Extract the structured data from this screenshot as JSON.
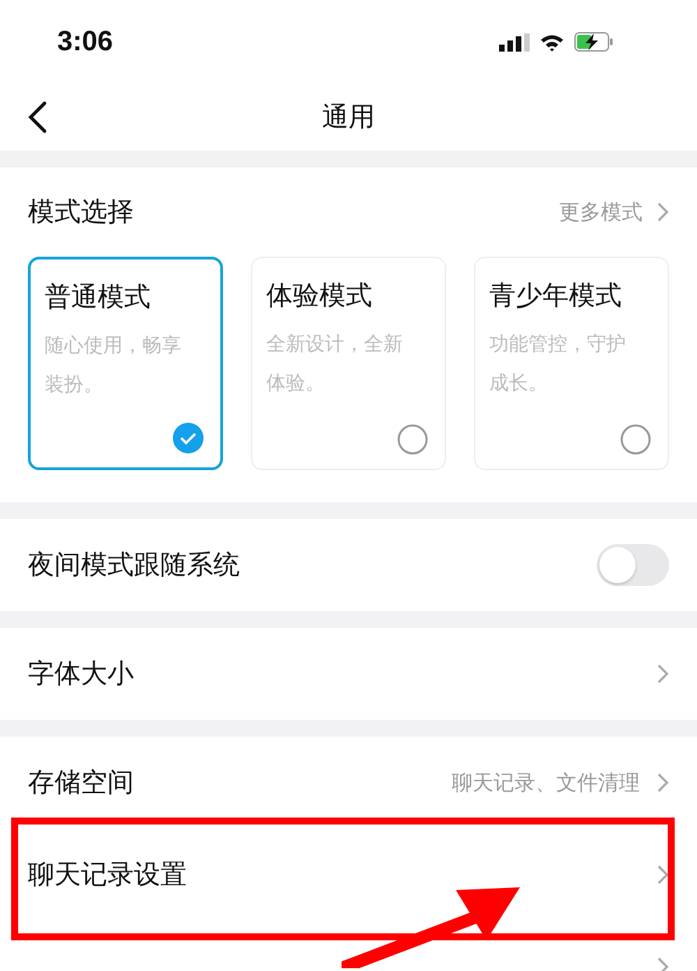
{
  "status_bar": {
    "time": "3:06"
  },
  "nav": {
    "title": "通用"
  },
  "mode_section": {
    "title": "模式选择",
    "more": "更多模式",
    "modes": [
      {
        "name": "普通模式",
        "description": "随心使用，畅享装扮。",
        "selected": true
      },
      {
        "name": "体验模式",
        "description": "全新设计，全新体验。",
        "selected": false
      },
      {
        "name": "青少年模式",
        "description": "功能管控，守护成长。",
        "selected": false
      }
    ]
  },
  "groups": [
    [
      {
        "kind": "toggle",
        "label": "夜间模式跟随系统",
        "on": false
      }
    ],
    [
      {
        "kind": "link",
        "label": "字体大小"
      }
    ],
    [
      {
        "kind": "link",
        "label": "存储空间",
        "detail": "聊天记录、文件清理"
      },
      {
        "kind": "link",
        "label": "聊天记录设置",
        "highlighted": true
      },
      {
        "kind": "link"
      }
    ]
  ]
}
